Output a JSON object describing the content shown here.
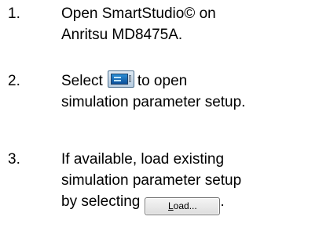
{
  "steps": [
    {
      "number": "1.",
      "lines": [
        "Open SmartStudio© on",
        "Anritsu MD8475A."
      ]
    },
    {
      "number": "2.",
      "line1_before": "Select",
      "line1_after": "to open",
      "line2": "simulation parameter setup."
    },
    {
      "number": "3.",
      "lines": [
        "If available, load existing",
        "simulation parameter setup"
      ],
      "line3_before": "by selecting",
      "line3_after": ".",
      "button_label": "Load...",
      "button_hotkey": "L"
    }
  ],
  "icons": {
    "setup_icon": "simulation-setup-icon"
  }
}
